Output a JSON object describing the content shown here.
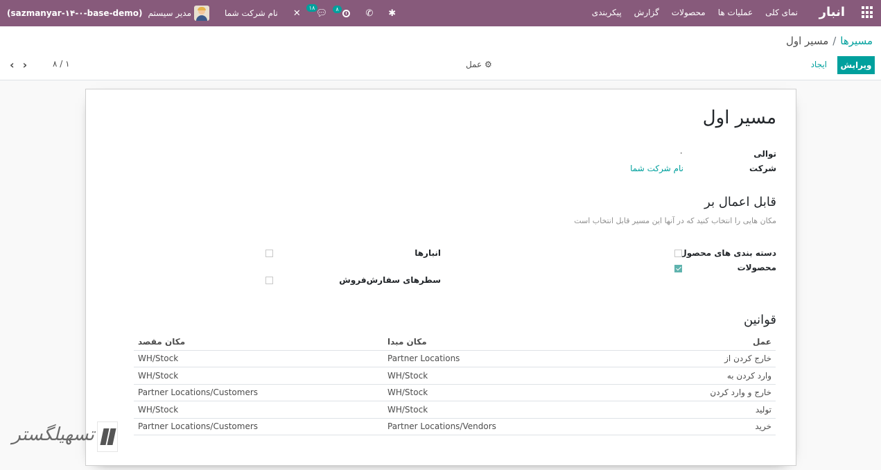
{
  "navbar": {
    "app_name": "انبار",
    "menu": [
      "نمای کلی",
      "عملیات ها",
      "محصولات",
      "گزارش",
      "پیکربندی"
    ],
    "company": "نام شرکت شما",
    "user_name": "مدیر سیستم",
    "database": "(sazmanyar-۱۴-۰-base-demo)",
    "messages_count": "۱۸",
    "activities_count": "۸",
    "accent_color": "#875a7b"
  },
  "control": {
    "breadcrumb_parent": "مسیرها",
    "breadcrumb_sep": "/",
    "breadcrumb_current": "مسیر اول",
    "edit_label": "ویرایش",
    "create_label": "ایجاد",
    "action_label": "عمل",
    "pager": "۸ / ۱",
    "prev_icon": "chevron-left",
    "next_icon": "chevron-right"
  },
  "form": {
    "title": "مسیر اول",
    "sequence_label": "توالی",
    "sequence_value": "۰",
    "company_label": "شرکت",
    "company_value": "نام شرکت شما",
    "applicable_title": "قابل اعمال بر",
    "applicable_hint": "مکان هایی را انتخاب کنید که در آنها این مسیر قابل انتخاب است",
    "checks": {
      "product_categories": {
        "label": "دسته بندی های محصول",
        "checked": false
      },
      "products": {
        "label": "محصولات",
        "checked": true
      },
      "warehouses": {
        "label": "انبارها",
        "checked": false
      },
      "sales_lines": {
        "label": "سطرهای سفارش‌فروش",
        "checked": false
      }
    },
    "rules_title": "قوانین",
    "rules_headers": {
      "action": "عمل",
      "source": "مکان مبدا",
      "destination": "مکان مقصد"
    },
    "rules": [
      {
        "action": "خارج کردن از",
        "source": "Partner Locations",
        "destination": "WH/Stock"
      },
      {
        "action": "وارد کردن به",
        "source": "WH/Stock",
        "destination": "WH/Stock"
      },
      {
        "action": "خارج و وارد کردن",
        "source": "WH/Stock",
        "destination": "Partner Locations/Customers"
      },
      {
        "action": "تولید",
        "source": "WH/Stock",
        "destination": "WH/Stock"
      },
      {
        "action": "خرید",
        "source": "Partner Locations/Vendors",
        "destination": "Partner Locations/Customers"
      }
    ]
  }
}
